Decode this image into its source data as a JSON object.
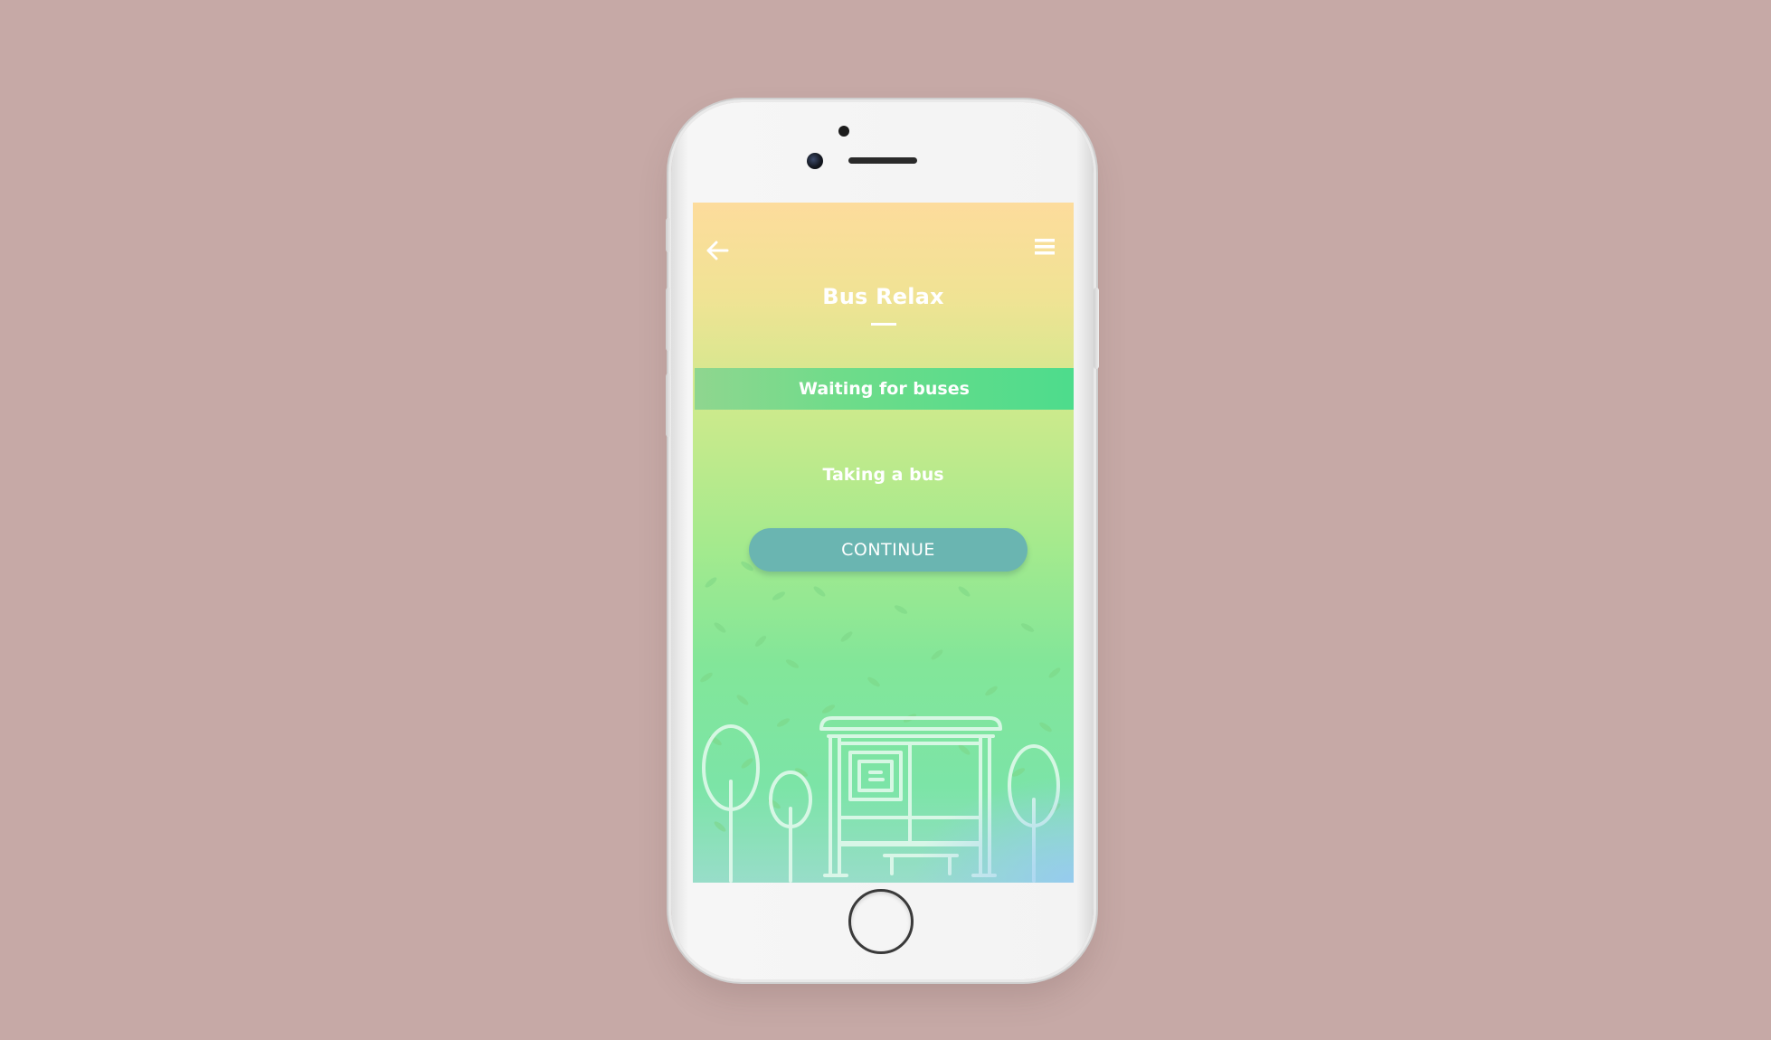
{
  "app": {
    "title": "Bus Relax",
    "banner_label": "Waiting for buses",
    "subtitle": "Taking a bus",
    "continue_label": "CONTINUE"
  },
  "icons": {
    "back": "arrow-left-icon",
    "menu": "hamburger-menu-icon",
    "illustration": "bus-stop-shelter-illustration"
  },
  "colors": {
    "background": "#c6a9a6",
    "button": "#6ab5b1",
    "banner": "#4ddc8c",
    "text": "#ffffff"
  }
}
